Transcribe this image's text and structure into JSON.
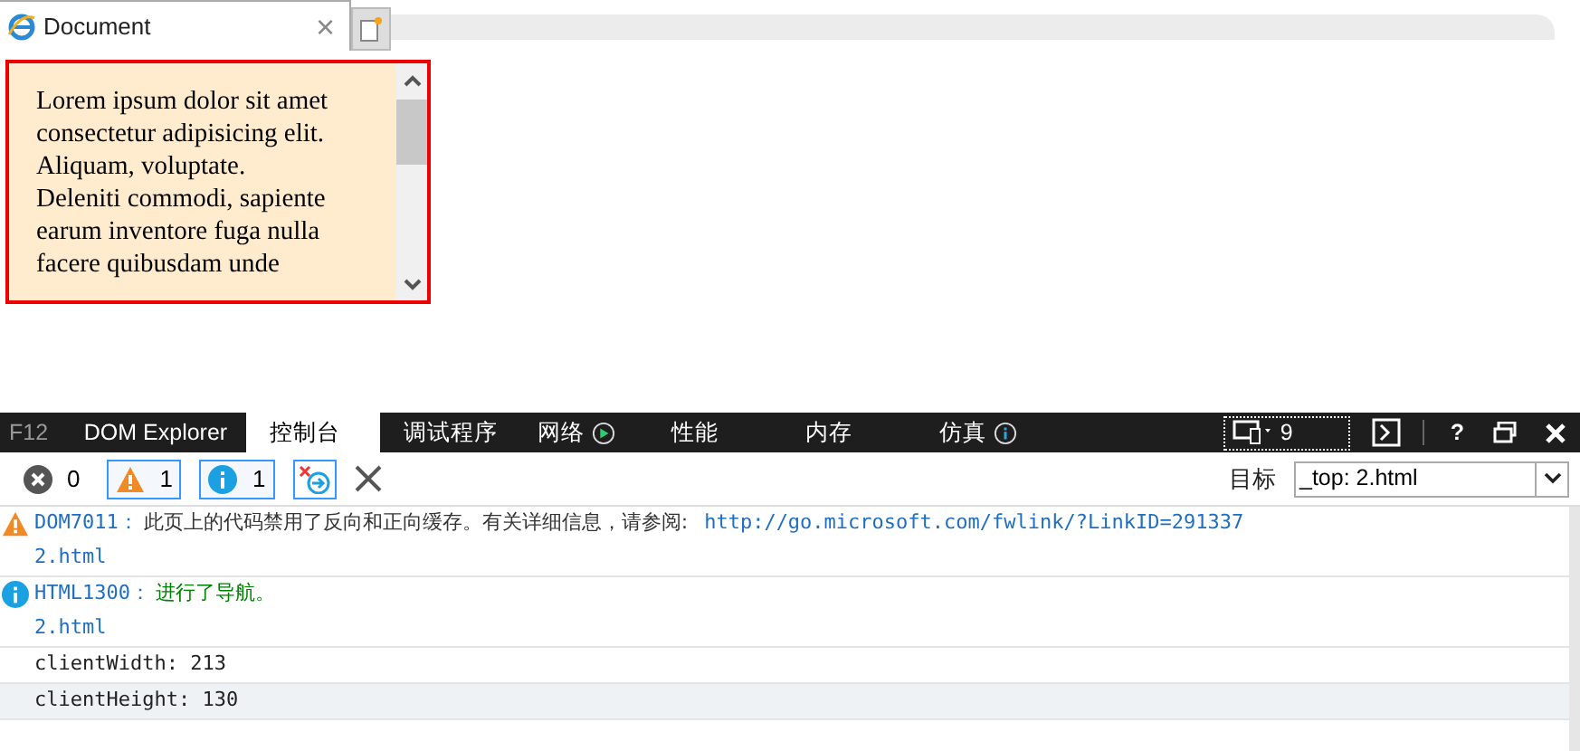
{
  "browser_tab": {
    "title": "Document",
    "close": "×"
  },
  "content_box": {
    "lines": [
      "Lorem ipsum dolor sit amet",
      "consectetur adipisicing elit.",
      "Aliquam, voluptate.",
      "Deleniti commodi, sapiente",
      "earum inventore fuga nulla",
      "facere quibusdam unde"
    ]
  },
  "devtools": {
    "f12": "F12",
    "tabs": [
      {
        "label": "DOM Explorer",
        "selected": false,
        "kind": "plain"
      },
      {
        "label": "控制台",
        "selected": true,
        "kind": "plain"
      },
      {
        "label": "调试程序",
        "selected": false,
        "kind": "plain"
      },
      {
        "label": "网络",
        "selected": false,
        "kind": "play"
      },
      {
        "label": "性能",
        "selected": false,
        "kind": "plain"
      },
      {
        "label": "内存",
        "selected": false,
        "kind": "plain"
      },
      {
        "label": "仿真",
        "selected": false,
        "kind": "info"
      }
    ],
    "device_count": "9",
    "help": "?",
    "filters": [
      {
        "kind": "error",
        "count": "0",
        "selected": false
      },
      {
        "kind": "warning",
        "count": "1",
        "selected": true
      },
      {
        "kind": "info",
        "count": "1",
        "selected": true
      }
    ],
    "target_label": "目标",
    "target_value": "_top: 2.html",
    "messages": [
      {
        "kind": "warning",
        "code": "DOM7011：",
        "text": "此页上的代码禁用了反向和正向缓存。有关详细信息，请参阅:",
        "link": "http://go.microsoft.com/fwlink/?LinkID=291337",
        "source": "2.html"
      },
      {
        "kind": "info",
        "code": "HTML1300：",
        "text": "进行了导航。",
        "source": "2.html"
      },
      {
        "kind": "log",
        "text": "clientWidth: 213",
        "selected": false
      },
      {
        "kind": "log",
        "text": "clientHeight: 130",
        "selected": true
      }
    ]
  }
}
